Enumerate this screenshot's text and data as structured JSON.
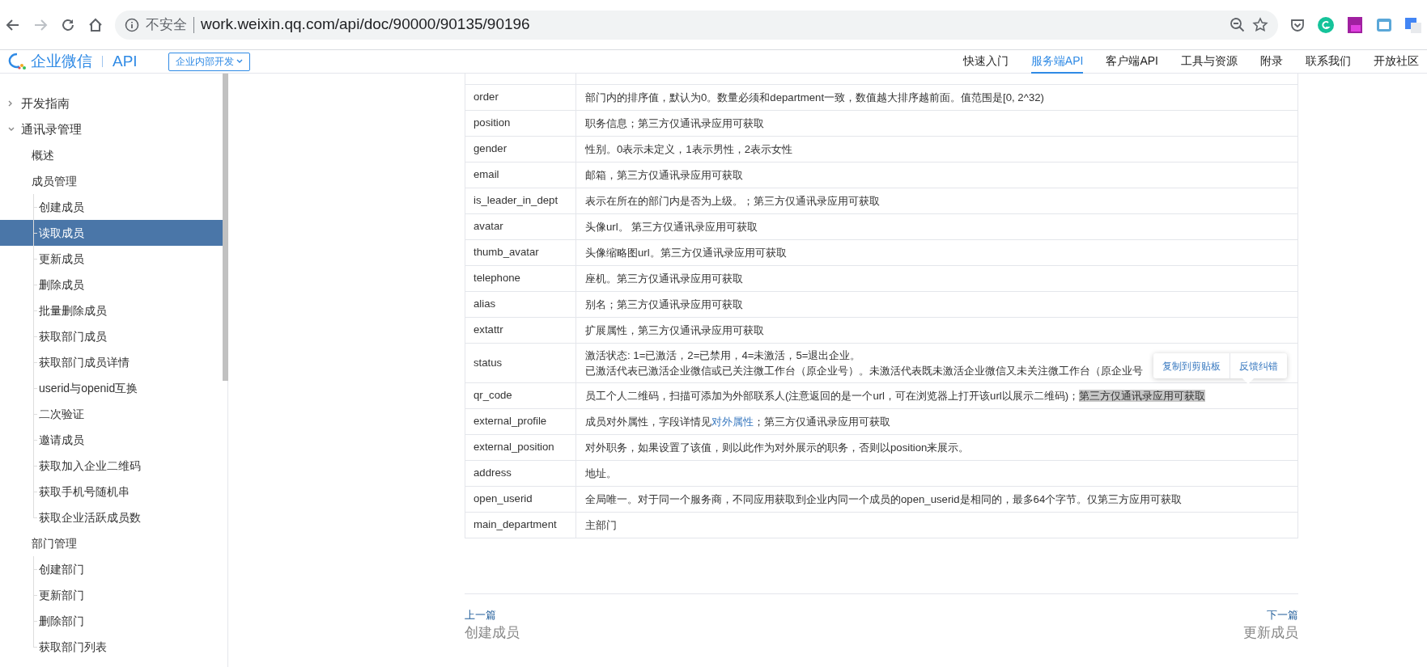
{
  "browser": {
    "security_label": "不安全",
    "url": "work.weixin.qq.com/api/doc/90000/90135/90196"
  },
  "header": {
    "logo_text": "企业微信",
    "product": "API",
    "scope_button": "企业内部开发",
    "nav": [
      {
        "label": "快速入门",
        "selected": false
      },
      {
        "label": "服务端API",
        "selected": true
      },
      {
        "label": "客户端API",
        "selected": false
      },
      {
        "label": "工具与资源",
        "selected": false
      },
      {
        "label": "附录",
        "selected": false
      },
      {
        "label": "联系我们",
        "selected": false
      },
      {
        "label": "开放社区",
        "selected": false
      }
    ]
  },
  "sidebar": {
    "items": [
      {
        "label": "开发指南",
        "expanded": false,
        "selected": false
      },
      {
        "label": "通讯录管理",
        "expanded": true,
        "selected": false,
        "children": [
          {
            "label": "概述",
            "selected": false
          },
          {
            "label": "成员管理",
            "selected": false,
            "children": [
              {
                "label": "创建成员",
                "selected": false
              },
              {
                "label": "读取成员",
                "selected": true
              },
              {
                "label": "更新成员",
                "selected": false
              },
              {
                "label": "删除成员",
                "selected": false
              },
              {
                "label": "批量删除成员",
                "selected": false
              },
              {
                "label": "获取部门成员",
                "selected": false
              },
              {
                "label": "获取部门成员详情",
                "selected": false
              },
              {
                "label": "userid与openid互换",
                "selected": false
              },
              {
                "label": "二次验证",
                "selected": false
              },
              {
                "label": "邀请成员",
                "selected": false
              },
              {
                "label": "获取加入企业二维码",
                "selected": false
              },
              {
                "label": "获取手机号随机串",
                "selected": false
              },
              {
                "label": "获取企业活跃成员数",
                "selected": false
              }
            ]
          },
          {
            "label": "部门管理",
            "selected": false,
            "children": [
              {
                "label": "创建部门",
                "selected": false
              },
              {
                "label": "更新部门",
                "selected": false
              },
              {
                "label": "删除部门",
                "selected": false
              },
              {
                "label": "获取部门列表",
                "selected": false
              }
            ]
          }
        ]
      }
    ]
  },
  "table": {
    "rows": [
      {
        "name": "order",
        "lines": [
          [
            {
              "kind": "plain",
              "text": "部门内的排序值，默认为0。数量必须和department一致，数值越大排序越前面。值范围是[0, 2^32)"
            }
          ]
        ]
      },
      {
        "name": "position",
        "lines": [
          [
            {
              "kind": "plain",
              "text": "职务信息；第三方仅通讯录应用可获取"
            }
          ]
        ]
      },
      {
        "name": "gender",
        "lines": [
          [
            {
              "kind": "plain",
              "text": "性别。0表示未定义，1表示男性，2表示女性"
            }
          ]
        ]
      },
      {
        "name": "email",
        "lines": [
          [
            {
              "kind": "plain",
              "text": "邮箱，第三方仅通讯录应用可获取"
            }
          ]
        ]
      },
      {
        "name": "is_leader_in_dept",
        "lines": [
          [
            {
              "kind": "plain",
              "text": "表示在所在的部门内是否为上级。；第三方仅通讯录应用可获取"
            }
          ]
        ]
      },
      {
        "name": "avatar",
        "lines": [
          [
            {
              "kind": "plain",
              "text": "头像url。 第三方仅通讯录应用可获取"
            }
          ]
        ]
      },
      {
        "name": "thumb_avatar",
        "lines": [
          [
            {
              "kind": "plain",
              "text": "头像缩略图url。第三方仅通讯录应用可获取"
            }
          ]
        ]
      },
      {
        "name": "telephone",
        "lines": [
          [
            {
              "kind": "plain",
              "text": "座机。第三方仅通讯录应用可获取"
            }
          ]
        ]
      },
      {
        "name": "alias",
        "lines": [
          [
            {
              "kind": "plain",
              "text": "别名；第三方仅通讯录应用可获取"
            }
          ]
        ]
      },
      {
        "name": "extattr",
        "lines": [
          [
            {
              "kind": "plain",
              "text": "扩展属性，第三方仅通讯录应用可获取"
            }
          ]
        ]
      },
      {
        "name": "status",
        "lines": [
          [
            {
              "kind": "plain",
              "text": "激活状态: 1=已激活，2=已禁用，4=未激活，5=退出企业。"
            }
          ],
          [
            {
              "kind": "plain",
              "text": "已激活代表已激活企业微信或已关注微工作台（原企业号）。未激活代表既未激活企业微信又未关注微工作台（原企业号"
            }
          ]
        ]
      },
      {
        "name": "qr_code",
        "lines": [
          [
            {
              "kind": "plain",
              "text": "员工个人二维码，扫描可添加为外部联系人(注意返回的是一个url，可在浏览器上打开该url以展示二维码)；"
            },
            {
              "kind": "highlight",
              "text": "第三方仅通讯录应用可获取"
            }
          ]
        ]
      },
      {
        "name": "external_profile",
        "lines": [
          [
            {
              "kind": "plain",
              "text": "成员对外属性，字段详情见"
            },
            {
              "kind": "link",
              "text": "对外属性"
            },
            {
              "kind": "plain",
              "text": "；第三方仅通讯录应用可获取"
            }
          ]
        ]
      },
      {
        "name": "external_position",
        "lines": [
          [
            {
              "kind": "plain",
              "text": "对外职务，如果设置了该值，则以此作为对外展示的职务，否则以position来展示。"
            }
          ]
        ]
      },
      {
        "name": "address",
        "lines": [
          [
            {
              "kind": "plain",
              "text": "地址。"
            }
          ]
        ]
      },
      {
        "name": "open_userid",
        "lines": [
          [
            {
              "kind": "plain",
              "text": "全局唯一。对于同一个服务商，不同应用获取到企业内同一个成员的open_userid是相同的，最多64个字节。仅第三方应用可获取"
            }
          ]
        ]
      },
      {
        "name": "main_department",
        "lines": [
          [
            {
              "kind": "plain",
              "text": "主部门"
            }
          ]
        ]
      }
    ]
  },
  "selection_popup": {
    "actions": [
      "复制到剪贴板",
      "反馈纠错"
    ]
  },
  "pager": {
    "previous": {
      "caption": "上一篇",
      "title": "创建成员"
    },
    "next": {
      "caption": "下一篇",
      "title": "更新成员"
    }
  }
}
